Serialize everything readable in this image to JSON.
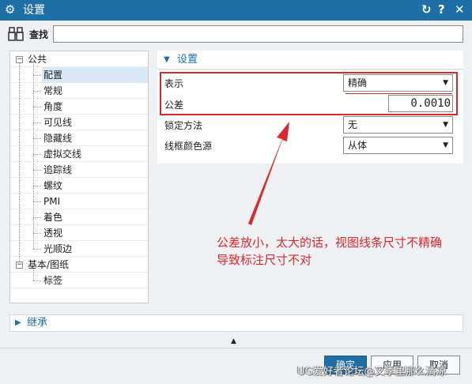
{
  "window": {
    "title": "设置",
    "title_icon": "gear-icon",
    "controls": {
      "reset_icon": "↻",
      "help_icon": "?",
      "close_icon": "✕"
    }
  },
  "search": {
    "label": "查找",
    "value": "",
    "placeholder": ""
  },
  "tree": {
    "groups": [
      {
        "label": "公共",
        "expanded": true,
        "items": [
          "配置",
          "常规",
          "角度",
          "可见线",
          "隐藏线",
          "虚拟交线",
          "追踪线",
          "螺纹",
          "PMI",
          "着色",
          "透视",
          "光顺边"
        ]
      },
      {
        "label": "基本/图纸",
        "expanded": true,
        "items": [
          "标签"
        ]
      }
    ],
    "selected": "配置"
  },
  "settings_group": {
    "title": "设置",
    "fields": {
      "display": {
        "label": "表示",
        "value": "精确"
      },
      "tolerance": {
        "label": "公差",
        "value": "0.0010"
      },
      "lock_method": {
        "label": "锁定方法",
        "value": "无"
      },
      "wireframe_color_source": {
        "label": "线框颜色源",
        "value": "从体"
      }
    }
  },
  "annotation": {
    "text_line1": "公差放小，太大的话，视图线条尺寸不精确",
    "text_line2": "导致标注尺寸不对"
  },
  "inherit": {
    "title": "继承"
  },
  "buttons": {
    "ok": "确定",
    "apply": "应用",
    "cancel": "取消"
  },
  "watermark": "UG爱好者论坛@叉季里那么清凉",
  "colors": {
    "accent": "#1e6fa6",
    "annotation_red": "#e2242c"
  }
}
